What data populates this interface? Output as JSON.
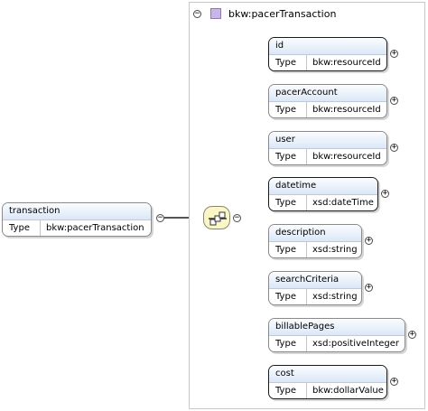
{
  "root": {
    "name": "transaction",
    "type_label": "Type",
    "type_value": "bkw:pacerTransaction"
  },
  "complex_type": {
    "name": "bkw:pacerTransaction"
  },
  "elements": [
    {
      "name": "id",
      "type_label": "Type",
      "type_value": "bkw:resourceId",
      "required": true
    },
    {
      "name": "pacerAccount",
      "type_label": "Type",
      "type_value": "bkw:resourceId",
      "required": false
    },
    {
      "name": "user",
      "type_label": "Type",
      "type_value": "bkw:resourceId",
      "required": false
    },
    {
      "name": "datetime",
      "type_label": "Type",
      "type_value": "xsd:dateTime",
      "required": true
    },
    {
      "name": "description",
      "type_label": "Type",
      "type_value": "xsd:string",
      "required": false
    },
    {
      "name": "searchCriteria",
      "type_label": "Type",
      "type_value": "xsd:string",
      "required": false
    },
    {
      "name": "billablePages",
      "type_label": "Type",
      "type_value": "xsd:positiveInteger",
      "required": false
    },
    {
      "name": "cost",
      "type_label": "Type",
      "type_value": "bkw:dollarValue",
      "required": true
    }
  ]
}
